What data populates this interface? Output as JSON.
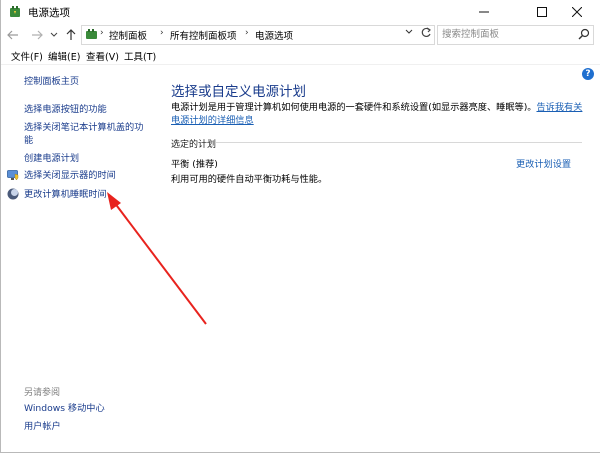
{
  "window": {
    "title": "电源选项"
  },
  "address": {
    "crumbs": [
      "控制面板",
      "所有控制面板项",
      "电源选项"
    ],
    "separator": "›"
  },
  "search": {
    "placeholder": "搜索控制面板"
  },
  "menu": [
    "文件(F)",
    "编辑(E)",
    "查看(V)",
    "工具(T)"
  ],
  "sidebar": {
    "home": "控制面板主页",
    "links": [
      "选择电源按钮的功能",
      "选择关闭笔记本计算机盖的功能",
      "创建电源计划",
      "选择关闭显示器的时间",
      "更改计算机睡眠时间"
    ],
    "see_also_title": "另请参阅",
    "see_also": [
      "Windows 移动中心",
      "用户帐户"
    ]
  },
  "main": {
    "title": "选择或自定义电源计划",
    "description": "电源计划是用于管理计算机如何使用电源的一套硬件和系统设置(如显示器亮度、睡眠等)。",
    "description_link": "告诉我有关电源计划的详细信息",
    "section_label": "选定的计划",
    "plan": {
      "name": "平衡 (推荐)",
      "description": "利用可用的硬件自动平衡功耗与性能。",
      "change_link": "更改计划设置"
    }
  },
  "colors": {
    "link": "#1a3c8c",
    "annotation_arrow": "#e8231e"
  }
}
